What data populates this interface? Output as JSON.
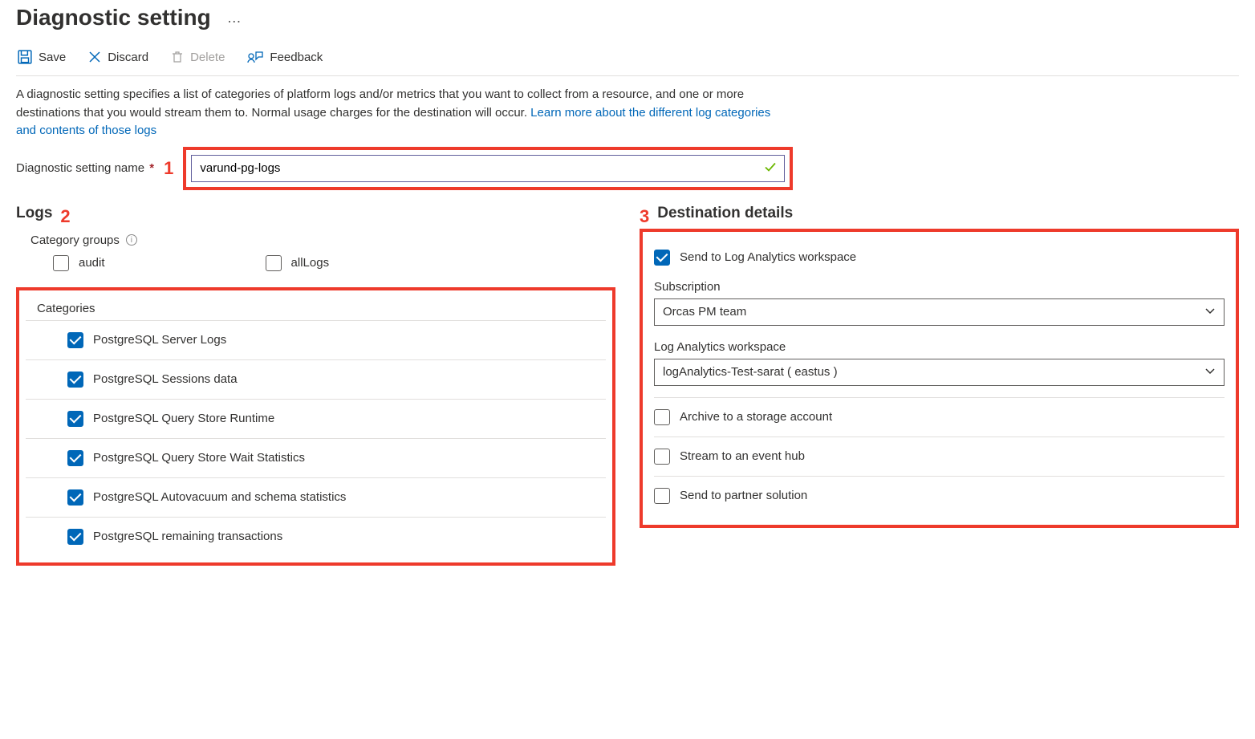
{
  "page": {
    "title": "Diagnostic setting",
    "ellipsis": "…"
  },
  "toolbar": {
    "save": "Save",
    "discard": "Discard",
    "delete": "Delete",
    "feedback": "Feedback"
  },
  "description": {
    "text": "A diagnostic setting specifies a list of categories of platform logs and/or metrics that you want to collect from a resource, and one or more destinations that you would stream them to. Normal usage charges for the destination will occur. ",
    "link": "Learn more about the different log categories and contents of those logs"
  },
  "nameField": {
    "label": "Diagnostic setting name",
    "required": "*",
    "value": "varund-pg-logs"
  },
  "callouts": {
    "one": "1",
    "two": "2",
    "three": "3"
  },
  "logs": {
    "heading": "Logs",
    "categoryGroupsLabel": "Category groups",
    "groups": [
      {
        "label": "audit",
        "checked": false
      },
      {
        "label": "allLogs",
        "checked": false
      }
    ],
    "categoriesLabel": "Categories",
    "categories": [
      {
        "label": "PostgreSQL Server Logs",
        "checked": true
      },
      {
        "label": "PostgreSQL Sessions data",
        "checked": true
      },
      {
        "label": "PostgreSQL Query Store Runtime",
        "checked": true
      },
      {
        "label": "PostgreSQL Query Store Wait Statistics",
        "checked": true
      },
      {
        "label": "PostgreSQL Autovacuum and schema statistics",
        "checked": true
      },
      {
        "label": "PostgreSQL remaining transactions",
        "checked": true
      }
    ]
  },
  "destination": {
    "heading": "Destination details",
    "options": {
      "logAnalytics": {
        "label": "Send to Log Analytics workspace",
        "checked": true
      },
      "storage": {
        "label": "Archive to a storage account",
        "checked": false
      },
      "eventHub": {
        "label": "Stream to an event hub",
        "checked": false
      },
      "partner": {
        "label": "Send to partner solution",
        "checked": false
      }
    },
    "subscription": {
      "label": "Subscription",
      "value": "Orcas PM team"
    },
    "workspace": {
      "label": "Log Analytics workspace",
      "value": "logAnalytics-Test-sarat ( eastus )"
    }
  }
}
